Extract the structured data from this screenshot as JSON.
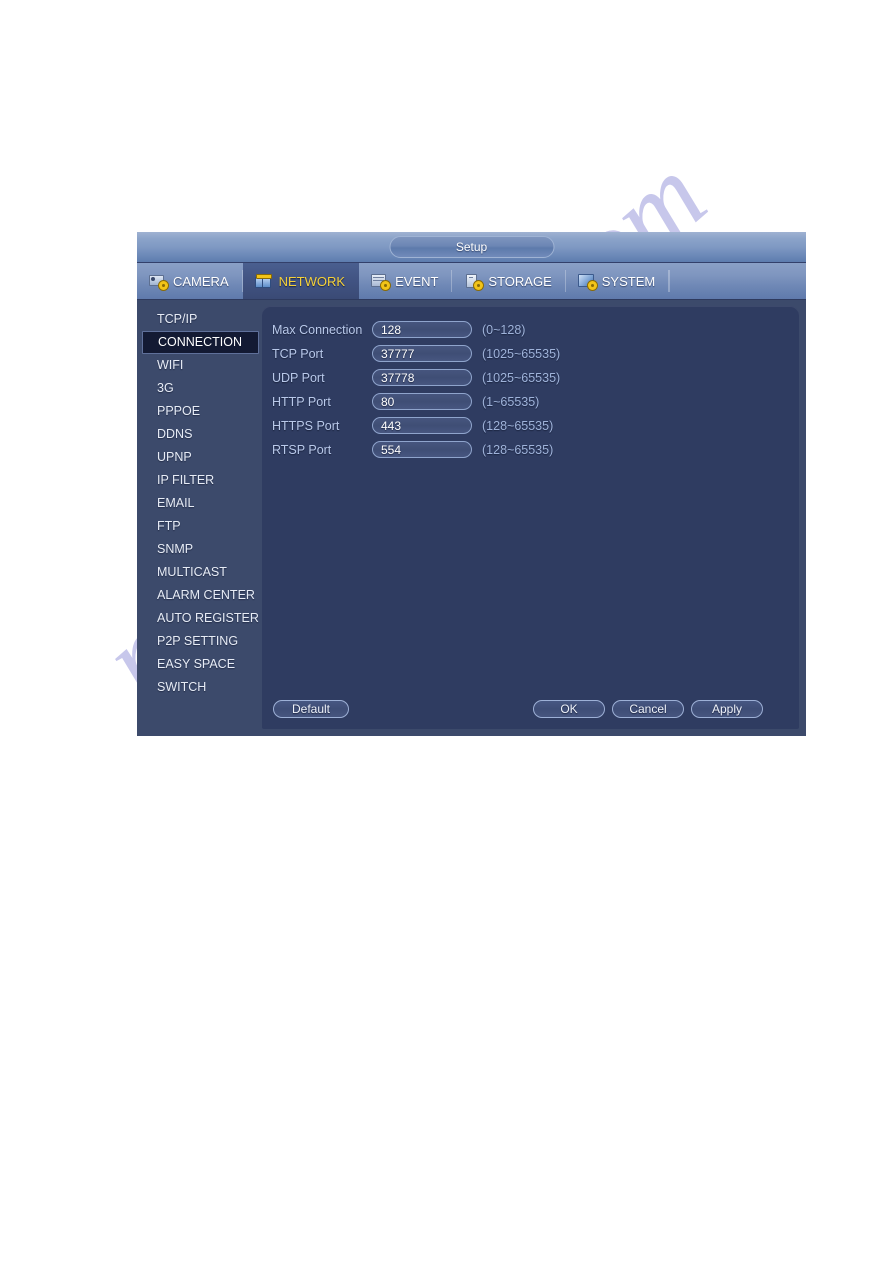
{
  "window": {
    "title": "Setup",
    "tabs": [
      {
        "label": "CAMERA",
        "icon": "camera-icon",
        "active": false
      },
      {
        "label": "NETWORK",
        "icon": "network-icon",
        "active": true
      },
      {
        "label": "EVENT",
        "icon": "event-icon",
        "active": false
      },
      {
        "label": "STORAGE",
        "icon": "storage-icon",
        "active": false
      },
      {
        "label": "SYSTEM",
        "icon": "system-icon",
        "active": false
      }
    ]
  },
  "sidebar": {
    "items": [
      {
        "label": "TCP/IP",
        "selected": false
      },
      {
        "label": "CONNECTION",
        "selected": true
      },
      {
        "label": "WIFI",
        "selected": false
      },
      {
        "label": "3G",
        "selected": false
      },
      {
        "label": "PPPOE",
        "selected": false
      },
      {
        "label": "DDNS",
        "selected": false
      },
      {
        "label": "UPNP",
        "selected": false
      },
      {
        "label": "IP FILTER",
        "selected": false
      },
      {
        "label": "EMAIL",
        "selected": false
      },
      {
        "label": "FTP",
        "selected": false
      },
      {
        "label": "SNMP",
        "selected": false
      },
      {
        "label": "MULTICAST",
        "selected": false
      },
      {
        "label": "ALARM CENTER",
        "selected": false
      },
      {
        "label": "AUTO REGISTER",
        "selected": false
      },
      {
        "label": "P2P SETTING",
        "selected": false
      },
      {
        "label": "EASY SPACE",
        "selected": false
      },
      {
        "label": "SWITCH",
        "selected": false
      }
    ]
  },
  "form": {
    "rows": [
      {
        "label": "Max Connection",
        "value": "128",
        "hint": "(0~128)"
      },
      {
        "label": "TCP Port",
        "value": "37777",
        "hint": "(1025~65535)"
      },
      {
        "label": "UDP Port",
        "value": "37778",
        "hint": "(1025~65535)"
      },
      {
        "label": "HTTP Port",
        "value": "80",
        "hint": "(1~65535)"
      },
      {
        "label": "HTTPS Port",
        "value": "443",
        "hint": "(128~65535)"
      },
      {
        "label": "RTSP Port",
        "value": "554",
        "hint": "(128~65535)"
      }
    ]
  },
  "footer": {
    "default_label": "Default",
    "ok_label": "OK",
    "cancel_label": "Cancel",
    "apply_label": "Apply"
  },
  "watermark": {
    "text": "manualshive.com"
  },
  "colors": {
    "accent_active_tab_text": "#f5d13a",
    "window_background": "#3c4a6b",
    "content_panel": "#2f3c61",
    "selected_item": "#131a33",
    "label_text": "#b9c9ea",
    "hint_text": "#9fb3da"
  }
}
